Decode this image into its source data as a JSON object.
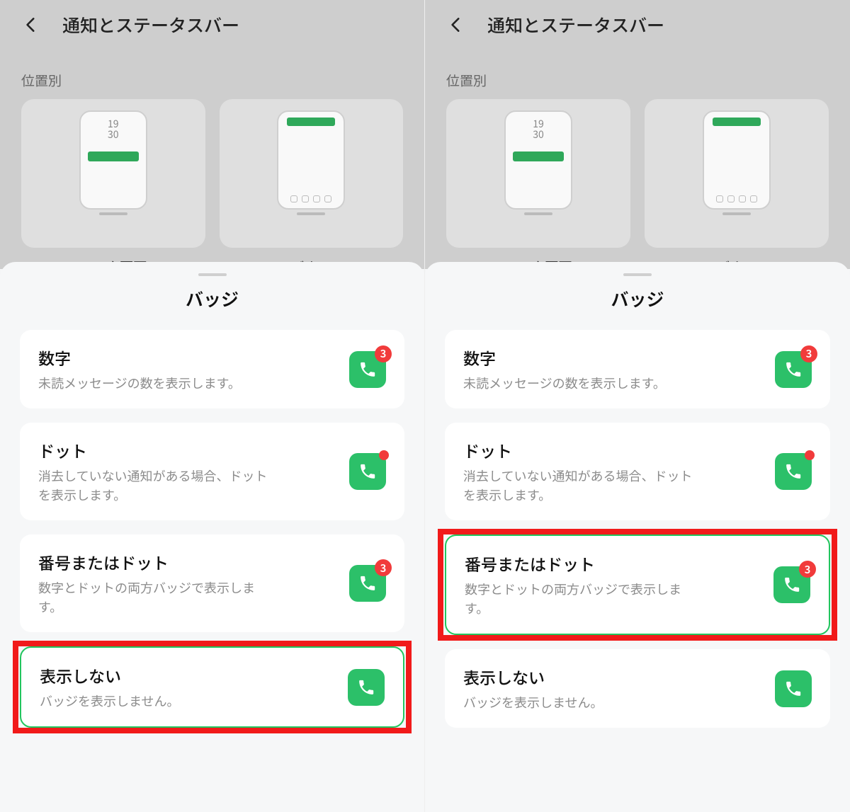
{
  "header": {
    "title": "通知とステータスバー"
  },
  "section": {
    "by_location": "位置別"
  },
  "previews": {
    "lock_screen": "ロック画面",
    "banner": "バナー",
    "mock_time1": "19",
    "mock_time2": "30"
  },
  "sheet": {
    "title": "バッジ"
  },
  "options": {
    "number": {
      "title": "数字",
      "sub": "未読メッセージの数を表示します。",
      "badge_value": "3"
    },
    "dot": {
      "title": "ドット",
      "sub": "消去していない通知がある場合、ドットを表示します。"
    },
    "number_or_dot": {
      "title": "番号またはドット",
      "sub": "数字とドットの両方バッジで表示します。",
      "badge_value": "3"
    },
    "none": {
      "title": "表示しない",
      "sub": "バッジを表示しません。"
    }
  },
  "panels": {
    "left": {
      "selected": "none",
      "highlighted": "none"
    },
    "right": {
      "selected": "number_or_dot",
      "highlighted": "number_or_dot"
    }
  }
}
